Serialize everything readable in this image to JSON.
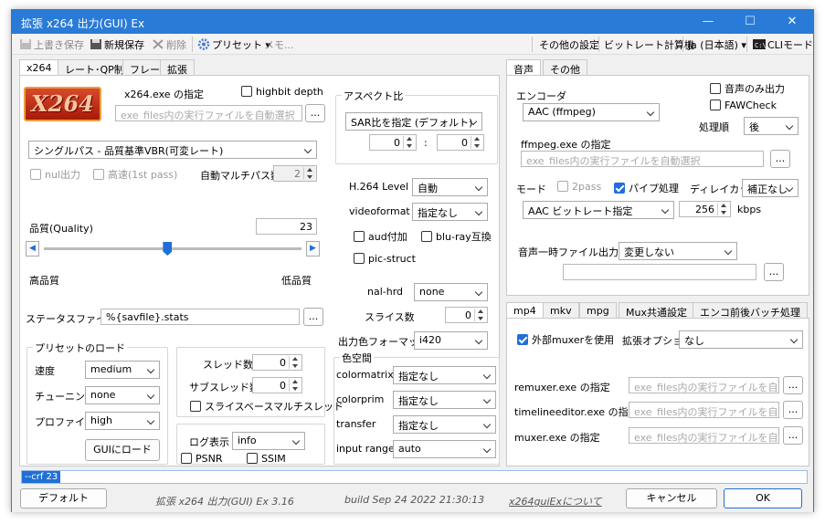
{
  "window": {
    "title": "拡張 x264 出力(GUI) Ex",
    "minimize": "—",
    "maximize": "☐",
    "close": "✕"
  },
  "toolbar": {
    "overwrite": "上書き保存",
    "new_save": "新規保存",
    "delete": "削除",
    "preset": "プリセット",
    "memo": "メモ...",
    "other_settings": "その他の設定",
    "bitrate_calc": "ビットレート計算機",
    "language": "ja (日本語)",
    "cli_mode": "CLIモード"
  },
  "left_tabs": [
    "x264",
    "レート･QP制御",
    "フレーム",
    "拡張"
  ],
  "x264": {
    "logo_text": "X264",
    "exe_label": "x264.exe の指定",
    "highbit": "highbit depth",
    "exe_placeholder": "exe_files内の実行ファイルを自動選択",
    "browse": "...",
    "mode": "シングルパス - 品質基準VBR(可変レート)",
    "nul_output": "nul出力",
    "fast_first": "高速(1st pass)",
    "auto_multipass": "自動マルチパス数",
    "auto_multipass_value": "2",
    "quality_label": "品質(Quality)",
    "quality_value": "23",
    "quality_level": 0.48,
    "high_quality": "高品質",
    "low_quality": "低品質",
    "status_file_label": "ステータスファイル",
    "status_file_value": "%{savfile}.stats",
    "aspect": {
      "title": "アスペクト比",
      "sar": "SAR比を指定 (デフォルト)",
      "w": "0",
      "colon": ":",
      "h": "0"
    },
    "h264_level_label": "H.264 Level",
    "h264_level": "自動",
    "videoformat_label": "videoformat",
    "videoformat": "指定なし",
    "aud": "aud付加",
    "bluray": "blu-ray互換",
    "pic_struct": "pic-struct",
    "nal_hrd_label": "nal-hrd",
    "nal_hrd": "none",
    "slices_label": "スライス数",
    "slices": "0",
    "output_csp_label": "出力色フォーマット",
    "output_csp": "i420",
    "colorspace": {
      "title": "色空間",
      "colormatrix_label": "colormatrix",
      "colormatrix": "指定なし",
      "colorprim_label": "colorprim",
      "colorprim": "指定なし",
      "transfer_label": "transfer",
      "transfer": "指定なし",
      "input_range_label": "input range",
      "input_range": "auto"
    },
    "preset_load": {
      "title": "プリセットのロード",
      "speed_label": "速度",
      "speed": "medium",
      "tune_label": "チューニング",
      "tune": "none",
      "profile_label": "プロファイル",
      "profile": "high",
      "load_btn": "GUIにロード"
    },
    "threads_label": "スレッド数",
    "threads": "0",
    "subthreads_label": "サブスレッド数",
    "subthreads": "0",
    "sliced_threads": "スライスベースマルチスレッド",
    "log": {
      "title": "ログ表示",
      "value": "info",
      "psnr": "PSNR",
      "ssim": "SSIM"
    }
  },
  "right_tabs_top": [
    "音声",
    "その他"
  ],
  "audio": {
    "encoder_label": "エンコーダ",
    "encoder": "AAC (ffmpeg)",
    "audio_only": "音声のみ出力",
    "faw": "FAWCheck",
    "order_label": "処理順",
    "order": "後",
    "ffmpeg_label": "ffmpeg.exe の指定",
    "ffmpeg_placeholder": "exe_files内の実行ファイルを自動選択",
    "mode_label": "モード",
    "twopass": "2pass",
    "pipe": "パイプ処理",
    "delay_label": "ディレイカット",
    "delay": "補正なし",
    "bitrate_mode": "AAC ビットレート指定",
    "bitrate": "256",
    "kbps": "kbps",
    "temp_label": "音声一時ファイル出力先",
    "temp": "変更しない"
  },
  "right_tabs_bottom": [
    "mp4",
    "mkv",
    "mpg",
    "Mux共通設定",
    "エンコ前後バッチ処理"
  ],
  "mp4": {
    "external_muxer": "外部muxerを使用",
    "ext_opt_label": "拡張オプション",
    "ext_opt": "なし",
    "remuxer_label": "remuxer.exe の指定",
    "timeline_label": "timelineeditor.exe の指定",
    "muxer_label": "muxer.exe の指定",
    "placeholder": "exe_files内の実行ファイルを自動選択"
  },
  "cmdline": "--crf 23",
  "footer": {
    "default_btn": "デフォルト",
    "app_name": "拡張 x264 出力(GUI) Ex 3.16",
    "build": "build Sep 24 2022 21:30:13",
    "about_link": "x264guiExについて",
    "cancel": "キャンセル",
    "ok": "OK"
  },
  "colors": {
    "accent": "#1f6fd6",
    "titlebar": "#2a7bd7"
  }
}
